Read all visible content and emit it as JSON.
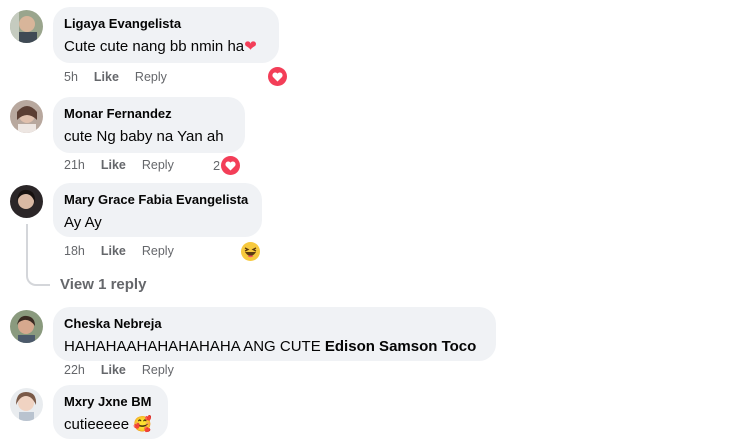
{
  "comments": [
    {
      "author": "Ligaya Evangelista",
      "text": "Cute cute nang bb nmin ha",
      "emoji": "❤",
      "time": "5h",
      "like": "Like",
      "reply": "Reply",
      "reaction": "heart",
      "count": ""
    },
    {
      "author": "Monar Fernandez",
      "text": "cute Ng baby na Yan ah",
      "time": "21h",
      "like": "Like",
      "reply": "Reply",
      "reaction": "heart",
      "count": "2"
    },
    {
      "author": "Mary Grace Fabia Evangelista",
      "text": "Ay Ay",
      "time": "18h",
      "like": "Like",
      "reply": "Reply",
      "reaction": "haha",
      "count": ""
    },
    {
      "author": "Cheska Nebreja",
      "text": "HAHAHAAHAHAHAHAHA ANG CUTE ",
      "tag": "Edison Samson Toco",
      "time": "22h",
      "like": "Like",
      "reply": "Reply"
    },
    {
      "author": "Mxry Jxne BM",
      "text": "cutieeeee",
      "emoji": "🥰"
    }
  ],
  "view_replies": "View 1 reply",
  "colors": {
    "bubble": "#f0f2f5",
    "meta": "#65676b",
    "heart": "#f33e58",
    "haha": "#f7c93e"
  }
}
